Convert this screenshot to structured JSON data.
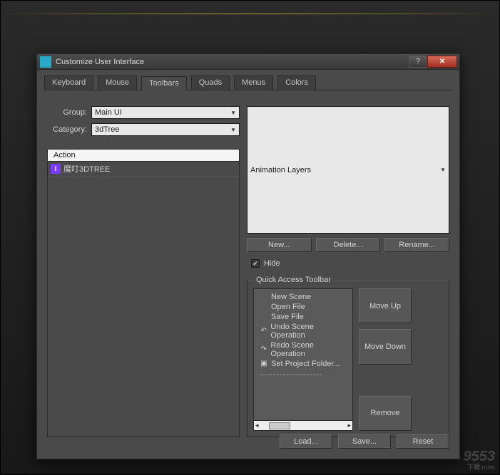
{
  "window": {
    "title": "Customize User Interface"
  },
  "tabs": [
    "Keyboard",
    "Mouse",
    "Toolbars",
    "Quads",
    "Menus",
    "Colors"
  ],
  "active_tab": 2,
  "left": {
    "group_label": "Group:",
    "group_value": "Main UI",
    "category_label": "Category:",
    "category_value": "3dTree"
  },
  "action_header": "Action",
  "action_items": [
    {
      "icon": "I",
      "label": "魔叮3DTREE"
    }
  ],
  "right": {
    "toolbar_dropdown": "Animation Layers",
    "new_btn": "New...",
    "delete_btn": "Delete...",
    "rename_btn": "Rename...",
    "hide_label": "Hide",
    "hide_checked": true
  },
  "qat": {
    "legend": "Quick Access Toolbar",
    "items": [
      {
        "icon": "",
        "label": "New Scene"
      },
      {
        "icon": "",
        "label": "Open File"
      },
      {
        "icon": "",
        "label": "Save File"
      },
      {
        "icon": "↶",
        "label": "Undo Scene Operation"
      },
      {
        "icon": "↷",
        "label": "Redo Scene Operation"
      },
      {
        "icon": "▣",
        "label": "Set Project Folder..."
      }
    ],
    "separator": "-------------------",
    "moveup": "Move Up",
    "movedown": "Move Down",
    "remove": "Remove"
  },
  "bottom": {
    "load": "Load...",
    "save": "Save...",
    "reset": "Reset"
  },
  "watermark": {
    "main": "9553",
    "sub": "下载.com"
  }
}
